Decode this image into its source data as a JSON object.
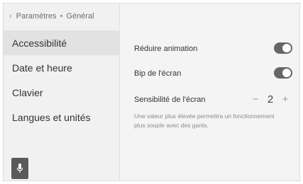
{
  "breadcrumb": {
    "back_icon": "chevron-left-icon",
    "parent": "Paramètres",
    "separator": "•",
    "current": "Général"
  },
  "sidebar": {
    "items": [
      {
        "label": "Accessibilité",
        "active": true
      },
      {
        "label": "Date et heure",
        "active": false
      },
      {
        "label": "Clavier",
        "active": false
      },
      {
        "label": "Langues et unités",
        "active": false
      }
    ],
    "voice_button_icon": "microphone-icon"
  },
  "settings": {
    "reduce_animation": {
      "label": "Réduire animation",
      "on": true
    },
    "screen_beep": {
      "label": "Bip de l'écran",
      "on": true
    },
    "screen_sensitivity": {
      "label": "Sensibilité de l'écran",
      "value": "2",
      "minus": "−",
      "plus": "+",
      "hint": "Une valeur plus élevée permettra un fonctionnement plus souple avec des gants."
    }
  },
  "colors": {
    "toggle_on": "#666666",
    "active_item": "#e2e2e2",
    "background": "#f4f4f4"
  }
}
